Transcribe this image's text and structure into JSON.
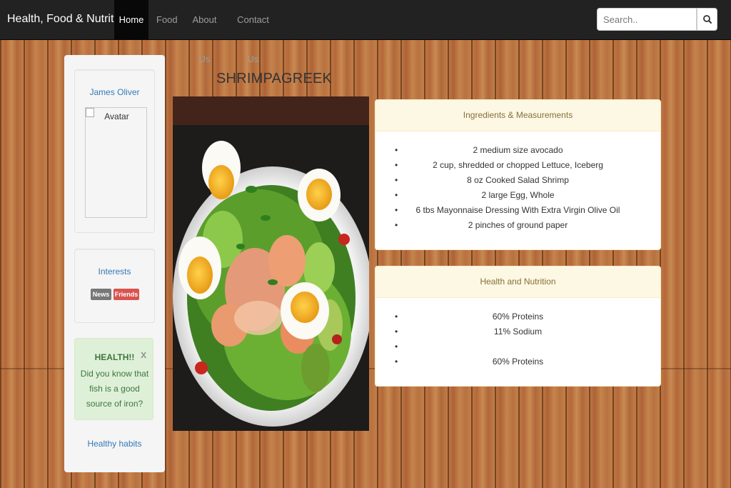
{
  "navbar": {
    "brand": "Health, Food & Nutrition",
    "items": [
      {
        "label": "Home",
        "active": true
      },
      {
        "label": "Food"
      },
      {
        "label": "About Us"
      },
      {
        "label": "Contact Us"
      }
    ],
    "search": {
      "placeholder": "Search.."
    }
  },
  "sidebar": {
    "profile": {
      "name": "James Oliver",
      "avatar_alt": "Avatar"
    },
    "interests": {
      "title": "Interests",
      "labels": [
        "News",
        "Friends"
      ]
    },
    "alert": {
      "close": "x",
      "title": "HEALTH!!",
      "body": "Did you know that fish is a good source of iron?"
    },
    "link": "Healthy habits"
  },
  "recipe": {
    "title": "SHRIMPAGREEK",
    "ingredients": {
      "heading": "Ingredients & Measurements",
      "items": [
        "2 medium size avocado",
        "2 cup, shredded or chopped Lettuce, Iceberg",
        "8 oz Cooked Salad Shrimp",
        "2 large Egg, Whole",
        "6 tbs Mayonnaise Dressing With Extra Virgin Olive Oil",
        "2 pinches of ground paper"
      ]
    },
    "nutrition": {
      "heading": "Health and Nutrition",
      "items": [
        "60% Proteins",
        "11% Sodium",
        "",
        "60% Proteins"
      ]
    }
  },
  "colors": {
    "navbar_bg": "#222222",
    "link_blue": "#337ab7",
    "panel_heading_bg": "#fcf8e3",
    "alert_bg": "#dff0d8",
    "label_news": "#777777",
    "label_friends": "#d9534f"
  }
}
